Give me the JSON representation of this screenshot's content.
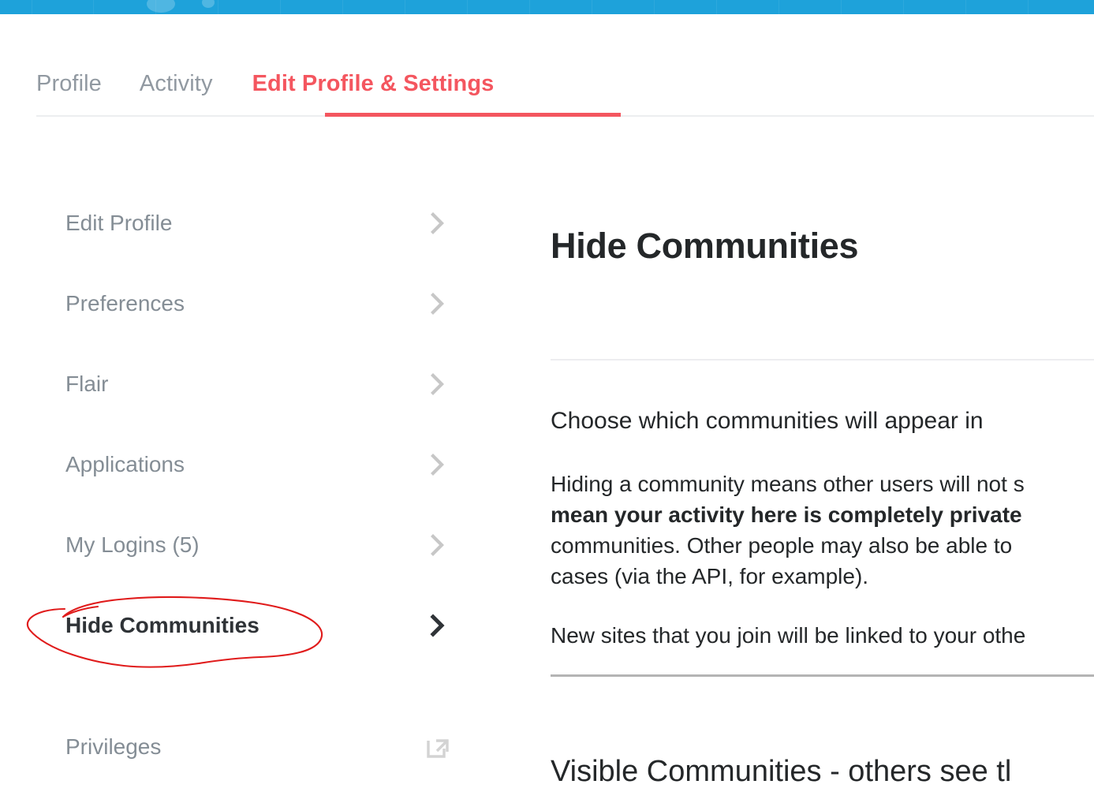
{
  "topbar": {
    "color": "#1ea2da",
    "name": "site-header-strip"
  },
  "tabs": {
    "items": [
      {
        "label": "Profile",
        "active": false
      },
      {
        "label": "Activity",
        "active": false
      },
      {
        "label": "Edit Profile & Settings",
        "active": true
      }
    ],
    "active_color": "#f4565f",
    "inactive_color": "#9199a1"
  },
  "sidebar": {
    "items": [
      {
        "label": "Edit Profile",
        "icon": "chevron-right-icon",
        "current": false
      },
      {
        "label": "Preferences",
        "icon": "chevron-right-icon",
        "current": false
      },
      {
        "label": "Flair",
        "icon": "chevron-right-icon",
        "current": false
      },
      {
        "label": "Applications",
        "icon": "chevron-right-icon",
        "current": false
      },
      {
        "label": "My Logins (5)",
        "icon": "chevron-right-icon",
        "current": false
      },
      {
        "label": "Hide Communities",
        "icon": "chevron-right-icon",
        "current": true
      }
    ],
    "external_items": [
      {
        "label": "Privileges",
        "icon": "external-link-icon"
      }
    ]
  },
  "annotation": {
    "shape": "hand-drawn-ellipse",
    "color": "#e01b1b",
    "targets": "Hide Communities"
  },
  "main": {
    "title": "Hide Communities",
    "lead": "Choose which communities will appear in",
    "paragraph_lines": [
      {
        "text": "Hiding a community means other users will not s",
        "bold": false
      },
      {
        "text": "mean your activity here is completely private",
        "bold": true
      },
      {
        "text": "communities. Other people may also be able to ",
        "bold": false
      },
      {
        "text": "cases (via the API, for example).",
        "bold": false
      }
    ],
    "paragraph2": "New sites that you join will be linked to your othe",
    "section_heading": "Visible Communities - others see tl"
  }
}
